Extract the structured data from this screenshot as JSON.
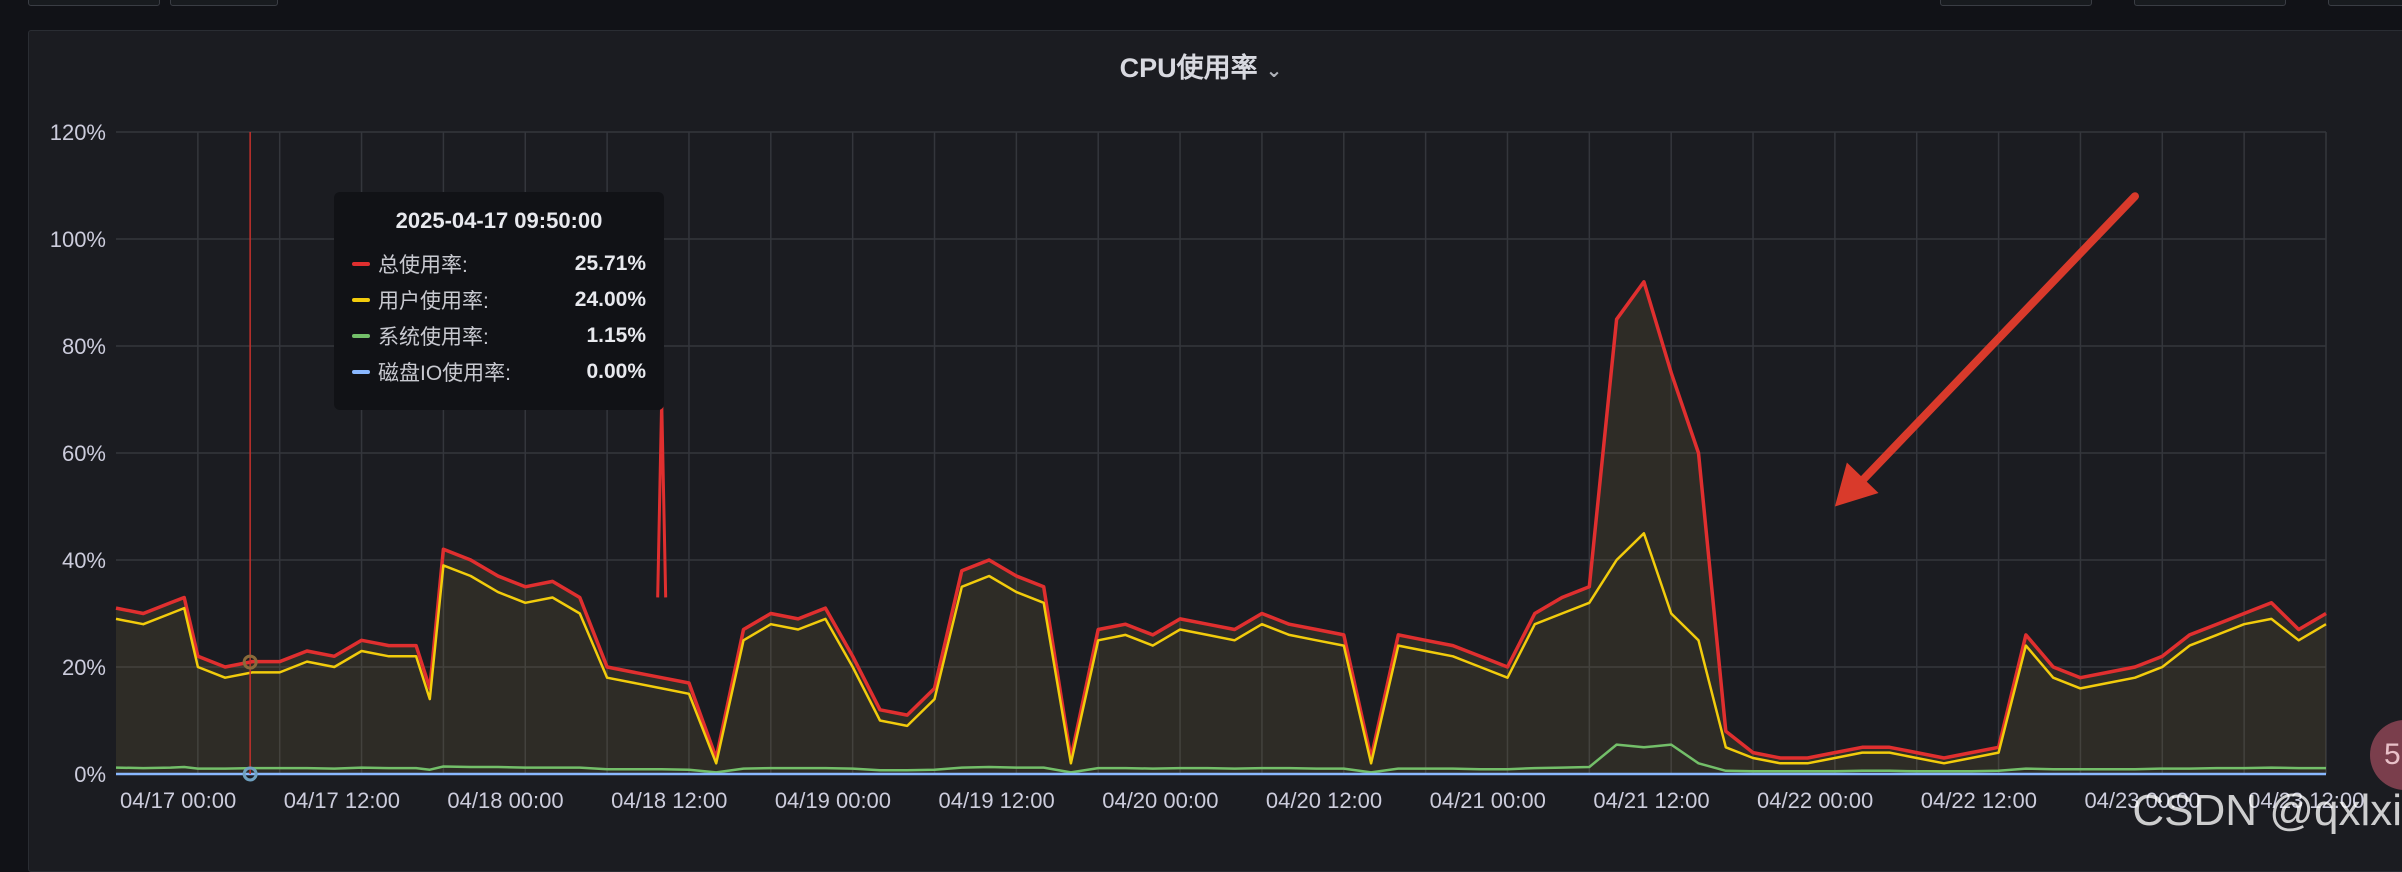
{
  "panel": {
    "title": "CPU使用率"
  },
  "tooltip": {
    "time": "2025-04-17 09:50:00",
    "rows": [
      {
        "label": "总使用率:",
        "value": "25.71%",
        "color": "#e02f2f"
      },
      {
        "label": "用户使用率:",
        "value": "24.00%",
        "color": "#f2cc0c"
      },
      {
        "label": "系统使用率:",
        "value": "1.15%",
        "color": "#73bf69"
      },
      {
        "label": "磁盘IO使用率:",
        "value": "0.00%",
        "color": "#8ab8ff"
      }
    ]
  },
  "watermark": "CSDN @qxlxi",
  "badge_text": "5",
  "chart_data": {
    "type": "line",
    "title": "CPU使用率",
    "xlabel": "",
    "ylabel": "",
    "ylim": [
      0,
      120
    ],
    "yticks": [
      "0%",
      "20%",
      "40%",
      "60%",
      "80%",
      "100%",
      "120%"
    ],
    "xlim": [
      "04/17 00:00",
      "04/23 18:00"
    ],
    "xticks": [
      "04/17 00:00",
      "04/17 12:00",
      "04/18 00:00",
      "04/18 12:00",
      "04/19 00:00",
      "04/19 12:00",
      "04/20 00:00",
      "04/20 12:00",
      "04/21 00:00",
      "04/21 12:00",
      "04/22 00:00",
      "04/22 12:00",
      "04/23 00:00",
      "04/23 12:00"
    ],
    "grid": true,
    "cursor_time": "2025-04-17 09:50:00",
    "x_hours": [
      0,
      2,
      4,
      5,
      6,
      8,
      10,
      12,
      14,
      16,
      18,
      20,
      22,
      23,
      24,
      26,
      28,
      30,
      32,
      34,
      36,
      38,
      40,
      42,
      44,
      46,
      48,
      50,
      52,
      54,
      56,
      58,
      60,
      62,
      64,
      66,
      68,
      70,
      72,
      74,
      76,
      78,
      80,
      82,
      84,
      86,
      88,
      90,
      92,
      94,
      96,
      98,
      100,
      102,
      104,
      106,
      108,
      110,
      112,
      114,
      116,
      118,
      120,
      122,
      124,
      126,
      128,
      130,
      132,
      134,
      136,
      138,
      140,
      142,
      144,
      146,
      148,
      150,
      152,
      154,
      156,
      158,
      160,
      162
    ],
    "series": [
      {
        "name": "总使用率",
        "color": "#e02f2f",
        "values": [
          31,
          30,
          32,
          33,
          22,
          20,
          21,
          21,
          23,
          22,
          25,
          24,
          24,
          16,
          42,
          40,
          37,
          35,
          36,
          33,
          20,
          19,
          18,
          17,
          3,
          27,
          30,
          29,
          31,
          22,
          12,
          11,
          16,
          38,
          40,
          37,
          35,
          3,
          27,
          28,
          26,
          29,
          28,
          27,
          30,
          28,
          27,
          26,
          3,
          26,
          25,
          24,
          22,
          20,
          30,
          33,
          35,
          85,
          92,
          75,
          60,
          8,
          4,
          3,
          3,
          4,
          5,
          5,
          4,
          3,
          4,
          5,
          26,
          20,
          18,
          19,
          20,
          22,
          26,
          28,
          30,
          32,
          27,
          30
        ]
      },
      {
        "name": "用户使用率",
        "color": "#f2cc0c",
        "values": [
          29,
          28,
          30,
          31,
          20,
          18,
          19,
          19,
          21,
          20,
          23,
          22,
          22,
          14,
          39,
          37,
          34,
          32,
          33,
          30,
          18,
          17,
          16,
          15,
          2,
          25,
          28,
          27,
          29,
          20,
          10,
          9,
          14,
          35,
          37,
          34,
          32,
          2,
          25,
          26,
          24,
          27,
          26,
          25,
          28,
          26,
          25,
          24,
          2,
          24,
          23,
          22,
          20,
          18,
          28,
          30,
          32,
          40,
          45,
          30,
          25,
          5,
          3,
          2,
          2,
          3,
          4,
          4,
          3,
          2,
          3,
          4,
          24,
          18,
          16,
          17,
          18,
          20,
          24,
          26,
          28,
          29,
          25,
          28
        ]
      },
      {
        "name": "系统使用率",
        "color": "#73bf69",
        "values": [
          1.2,
          1.1,
          1.2,
          1.3,
          1.0,
          1.0,
          1.1,
          1.1,
          1.1,
          1.0,
          1.2,
          1.1,
          1.1,
          0.8,
          1.4,
          1.3,
          1.3,
          1.2,
          1.2,
          1.2,
          0.9,
          0.9,
          0.9,
          0.8,
          0.3,
          1.0,
          1.1,
          1.1,
          1.1,
          1.0,
          0.7,
          0.7,
          0.8,
          1.2,
          1.3,
          1.2,
          1.2,
          0.3,
          1.1,
          1.1,
          1.0,
          1.1,
          1.1,
          1.0,
          1.1,
          1.1,
          1.0,
          1.0,
          0.3,
          1.0,
          1.0,
          1.0,
          0.9,
          0.9,
          1.1,
          1.2,
          1.3,
          5.5,
          5.0,
          5.5,
          2.0,
          0.6,
          0.5,
          0.5,
          0.5,
          0.5,
          0.6,
          0.6,
          0.5,
          0.5,
          0.5,
          0.6,
          1.0,
          0.9,
          0.9,
          0.9,
          0.9,
          1.0,
          1.0,
          1.1,
          1.1,
          1.2,
          1.1,
          1.1
        ]
      },
      {
        "name": "磁盘IO使用率",
        "color": "#8ab8ff",
        "values": [
          0,
          0,
          0,
          0,
          0,
          0,
          0,
          0,
          0,
          0,
          0,
          0,
          0,
          0,
          0,
          0,
          0,
          0,
          0,
          0,
          0,
          0,
          0,
          0,
          0,
          0,
          0,
          0,
          0,
          0,
          0,
          0,
          0,
          0,
          0,
          0,
          0,
          0,
          0,
          0,
          0,
          0,
          0,
          0,
          0,
          0,
          0,
          0,
          0,
          0,
          0,
          0,
          0,
          0,
          0,
          0,
          0,
          0,
          0,
          0,
          0,
          0,
          0,
          0,
          0,
          0,
          0,
          0,
          0,
          0,
          0,
          0,
          0,
          0,
          0,
          0,
          0,
          0,
          0,
          0,
          0,
          0,
          0,
          0
        ]
      }
    ],
    "annotations": [
      {
        "type": "arrow",
        "color": "#d93a2b",
        "from_hour": 148,
        "from_value": 108,
        "to_hour": 126,
        "to_value": 50
      },
      {
        "type": "spike",
        "series": "总使用率",
        "hour": 40,
        "value": 70
      }
    ]
  }
}
